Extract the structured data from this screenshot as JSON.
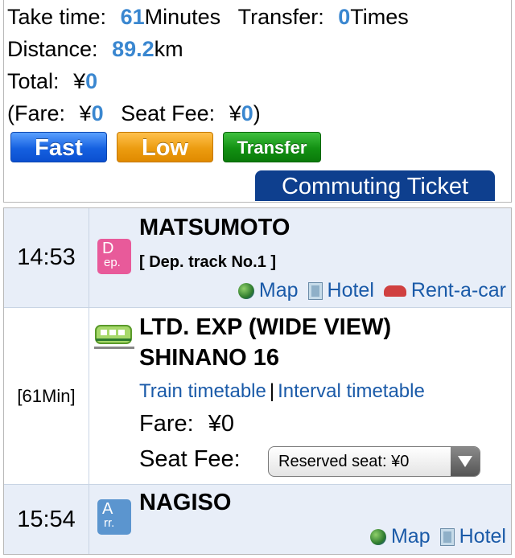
{
  "summary": {
    "take_time_label": "Take time:",
    "take_time_value": "61",
    "take_time_unit": "Minutes",
    "transfer_label": "Transfer:",
    "transfer_value": "0",
    "transfer_unit": "Times",
    "distance_label": "Distance:",
    "distance_value": "89.2",
    "distance_unit": "km",
    "total_label": "Total:",
    "total_currency": "¥",
    "total_value": "0",
    "fare_open": "(Fare:",
    "fare_currency": "¥",
    "fare_value": "0",
    "seat_fee_label": "Seat Fee:",
    "seat_fee_currency": "¥",
    "seat_fee_value": "0",
    "seat_fee_close": ")"
  },
  "route_buttons": {
    "fast": "Fast",
    "low": "Low",
    "transfer": "Transfer"
  },
  "commuting_ticket_label": "Commuting Ticket",
  "departure": {
    "time": "14:53",
    "badge_line1": "D",
    "badge_line2": "ep.",
    "station": "MATSUMOTO",
    "track": "[ Dep. track No.1 ]",
    "links": [
      "Map",
      "Hotel",
      "Rent-a-car"
    ]
  },
  "train": {
    "duration": "[61Min]",
    "name_line1": "LTD. EXP (WIDE VIEW)",
    "name_line2": "SHINANO 16",
    "train_timetable_link": "Train timetable",
    "separator": "|",
    "interval_timetable_link": "Interval timetable",
    "fare_label": "Fare:",
    "fare_value": "¥0",
    "seat_fee_label": "Seat Fee:",
    "seat_select_value": "Reserved seat: ¥0"
  },
  "arrival": {
    "time": "15:54",
    "badge_line1": "A",
    "badge_line2": "rr.",
    "station": "NAGISO",
    "links": [
      "Map",
      "Hotel"
    ]
  },
  "colors": {
    "highlight": "#3a87d0",
    "fast": "#1560e0",
    "low": "#ec9c10",
    "transfer": "#129012",
    "commute": "#0e3f8e",
    "link": "#1a5aa8",
    "station_row_bg": "#e8eef8",
    "dep_badge": "#e85a9a",
    "arr_badge": "#5b95cf"
  },
  "icons": {
    "map": "globe-icon",
    "hotel": "hotel-icon",
    "rent_a_car": "car-icon",
    "train": "train-icon",
    "select": "chevron-down-icon"
  }
}
